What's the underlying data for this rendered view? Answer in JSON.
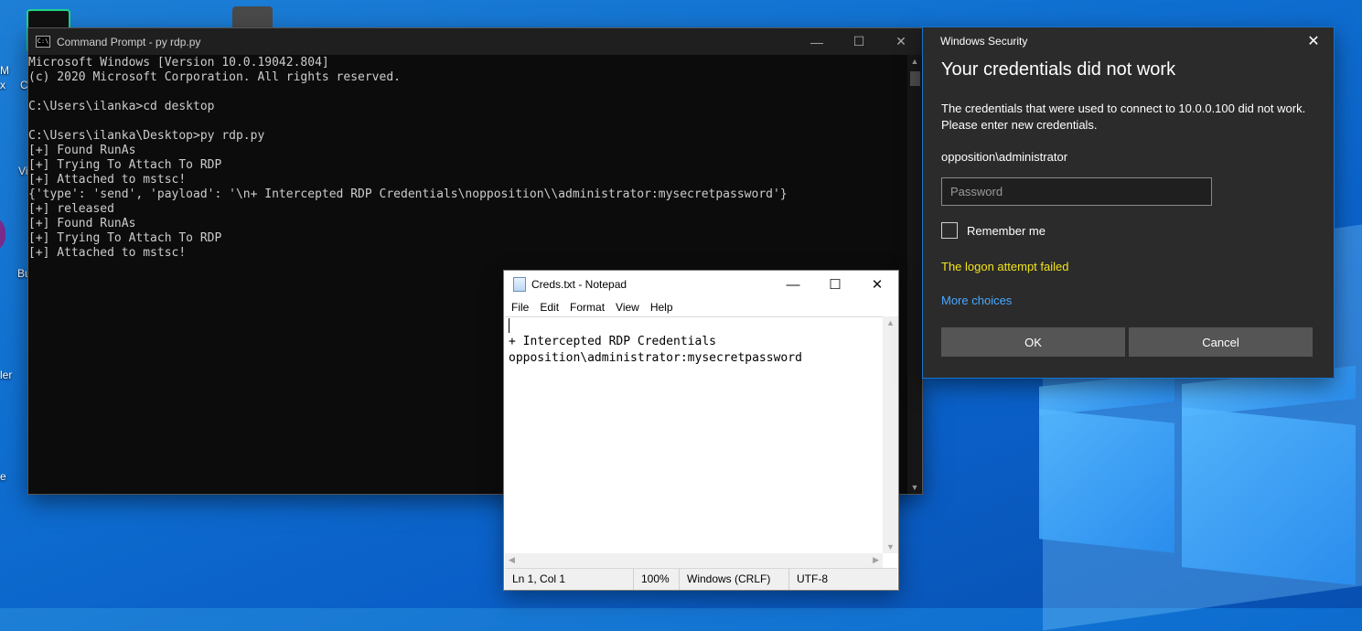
{
  "desktop": {
    "icon_labels": [
      "M",
      "x",
      "C",
      "Vi",
      "Bu",
      "ler",
      "e"
    ]
  },
  "cmd": {
    "title": "Command Prompt - py  rdp.py",
    "icon_text": "C:\\",
    "controls": {
      "minimize": "—",
      "maximize": "☐",
      "close": "✕"
    },
    "output": "Microsoft Windows [Version 10.0.19042.804]\n(c) 2020 Microsoft Corporation. All rights reserved.\n\nC:\\Users\\ilanka>cd desktop\n\nC:\\Users\\ilanka\\Desktop>py rdp.py\n[+] Found RunAs\n[+] Trying To Attach To RDP\n[+] Attached to mstsc!\n{'type': 'send', 'payload': '\\n+ Intercepted RDP Credentials\\nopposition\\\\administrator:mysecretpassword'}\n[+] released\n[+] Found RunAs\n[+] Trying To Attach To RDP\n[+] Attached to mstsc!"
  },
  "notepad": {
    "title": "Creds.txt - Notepad",
    "controls": {
      "minimize": "—",
      "maximize": "☐",
      "close": "✕"
    },
    "menu": [
      "File",
      "Edit",
      "Format",
      "View",
      "Help"
    ],
    "content": "\n+ Intercepted RDP Credentials\nopposition\\administrator:mysecretpassword",
    "status": {
      "position": "Ln 1, Col 1",
      "zoom": "100%",
      "line_endings": "Windows (CRLF)",
      "encoding": "UTF-8"
    }
  },
  "security": {
    "window_title": "Windows Security",
    "close": "✕",
    "heading": "Your credentials did not work",
    "message": "The credentials that were used to connect to 10.0.0.100 did not work. Please enter new credentials.",
    "username": "opposition\\administrator",
    "password_placeholder": "Password",
    "remember_label": "Remember me",
    "error": "The logon attempt failed",
    "more_choices": "More choices",
    "ok_label": "OK",
    "cancel_label": "Cancel",
    "colors": {
      "error": "#f2e31e",
      "link": "#4aa8ff",
      "background": "#2b2b2b"
    }
  }
}
